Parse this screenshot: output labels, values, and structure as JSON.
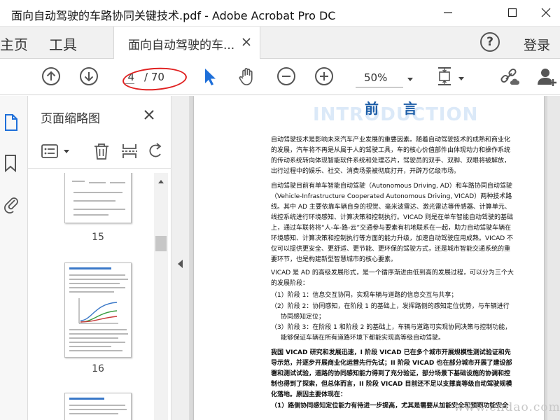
{
  "window": {
    "title": "面向自动驾驶的车路协同关键技术.pdf - Adobe Acrobat Pro DC"
  },
  "tabs": {
    "home": "主页",
    "tools": "工具",
    "document": "面向自动驾驶的车...",
    "login": "登录",
    "help": "?"
  },
  "toolbar": {
    "current_page": "4",
    "total_pages": "/ 70",
    "zoom": "50%"
  },
  "panel": {
    "title": "页面缩略图",
    "thumbnails": [
      "15",
      "16"
    ]
  },
  "document": {
    "watermark_heading": "INTRODUCTION",
    "heading": "前 言",
    "paragraphs": [
      "自动驾驶技术是影响未来汽车产业发展的重要因素。随着自动驾驶技术的成熟和商业化的发展，汽车将不再是从属于人的驾驶工具，车的核心价值部件由体现动力和操作系统的传动系统转向体现智能软件系统和处理芯片，驾驶员的双手、双脚、双眼将被解放，出行过程中的娱乐、社交、消费场景被彻底打开，开辟万亿级市场。",
      "自动驾驶目前有单车智能自动驾驶（Autonomous Driving, AD）和车路协同自动驾驶（Vehicle-Infrastructure Cooperated Autonomous Driving, VICAD）两种技术路线。其中 AD 主要依靠车辆自身的视觉、毫米波雷达、激光雷达等传感器、计算单元、线控系统进行环境感知、计算决策和控制执行。VICAD 则是在单车智能自动驾驶的基础上，通过车联将将“人-车-路-云”交通参与要素有机地联系在一起，助力自动驾驶车辆在环境感知、计算决策和控制执行等方面的能力升级，加速自动驾驶应用成熟。VICAD 不仅可以提供更安全、更舒适、更节能、更环保的驾驶方式，还是城市智能交通系统的重要环节，也是构建新型智慧城市的核心要素。",
      "VICAD 是 AD 的高级发展形式，是一个循序渐进由低到高的发展过程，可以分为三个大的发展阶段：",
      "（1）阶段 1：信息交互协同，实现车辆与道路的信息交互与共享；",
      "（2）阶段 2：协同感知，在阶段 1 的基础上，发挥路侧的感知定位优势，与车辆进行协同感知定位；",
      "（3）阶段 3：在阶段 1 和阶段 2 的基础上，车辆与道路可实现协同决策与控制功能，能够保证车辆在所有道路环境下都能实现高等级自动驾驶。",
      "我国 VICAD 研究和发展迅速，I 阶段 VICAD 已在多个城市开展规模性测试验证和先导示范，并逐步开展商业化运营先行先试；II 阶段 VICAD 也在部分城市开展了建设部署和测试试验，道路的协同感知能力得到了充分验证，部分场景下基础设施的协调和控制也得到了探索，但总体而言，II 阶段 VICAD 目前还不足以支撑高等级自动驾驶规模化落地。原因主要体现在：",
      "（1）路侧协同感知定位能力有待进一步提高，尤其是需要从加能安全和预期功能安全"
    ],
    "site_watermark": "www.cndao.com"
  }
}
